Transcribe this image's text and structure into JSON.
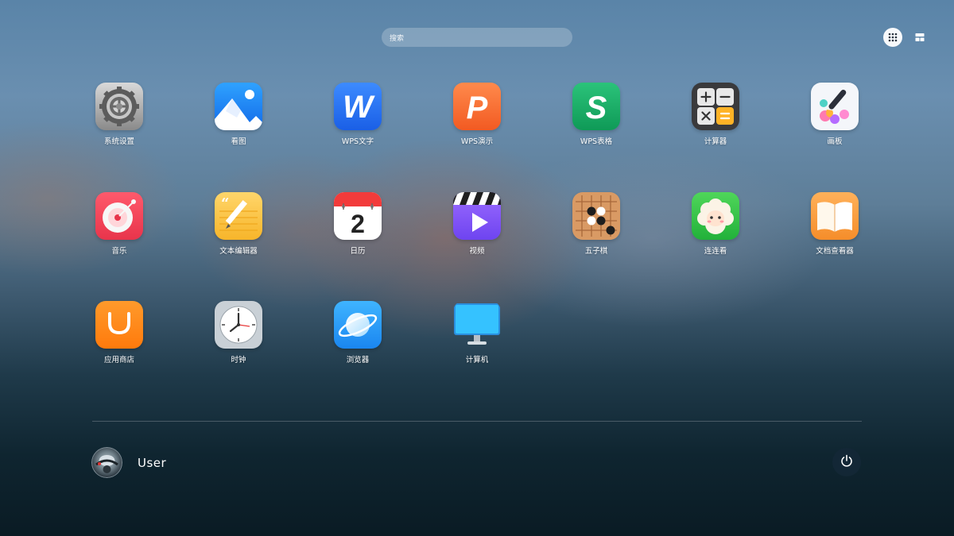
{
  "search": {
    "placeholder": "搜索"
  },
  "apps": [
    {
      "id": "system-settings",
      "label": "系统设置"
    },
    {
      "id": "image-viewer",
      "label": "看图"
    },
    {
      "id": "wps-writer",
      "label": "WPS文字"
    },
    {
      "id": "wps-presentation",
      "label": "WPS演示"
    },
    {
      "id": "wps-spreadsheet",
      "label": "WPS表格"
    },
    {
      "id": "calculator",
      "label": "计算器"
    },
    {
      "id": "drawing-board",
      "label": "画板"
    },
    {
      "id": "music",
      "label": "音乐"
    },
    {
      "id": "text-editor",
      "label": "文本编辑器"
    },
    {
      "id": "calendar",
      "label": "日历",
      "date": "2"
    },
    {
      "id": "video",
      "label": "视频"
    },
    {
      "id": "gomoku",
      "label": "五子棋"
    },
    {
      "id": "link-match",
      "label": "连连看"
    },
    {
      "id": "document-viewer",
      "label": "文档查看器"
    },
    {
      "id": "app-store",
      "label": "应用商店"
    },
    {
      "id": "clock",
      "label": "时钟"
    },
    {
      "id": "browser",
      "label": "浏览器"
    },
    {
      "id": "computer",
      "label": "计算机"
    }
  ],
  "user": {
    "name": "User"
  },
  "icons": {
    "grid_view": "grid-view-icon",
    "list_view": "list-view-icon",
    "power": "power-icon"
  }
}
